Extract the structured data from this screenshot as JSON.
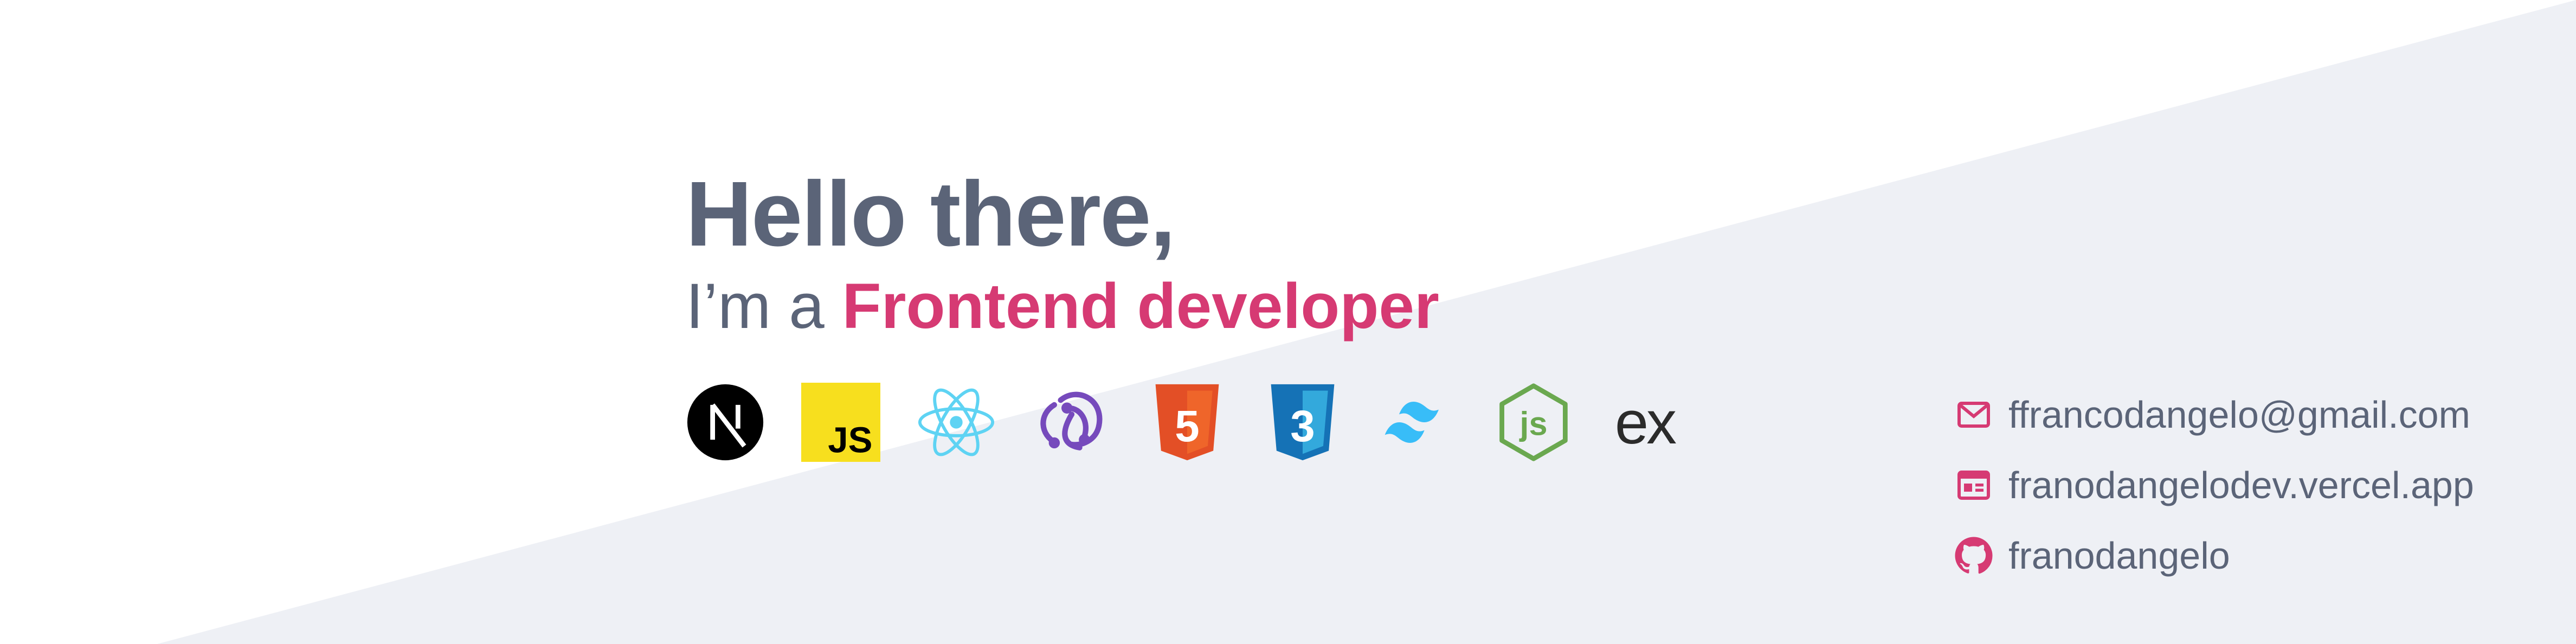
{
  "colors": {
    "background": "#ffffff",
    "diagonal_band": "#eef0f5",
    "text": "#5b6478",
    "accent": "#d63a73"
  },
  "intro": {
    "greeting": "Hello there,",
    "role_prefix": "I’m a ",
    "role": "Frontend developer"
  },
  "tech_icons": [
    {
      "icon": "nextjs-icon"
    },
    {
      "icon": "javascript-icon",
      "label": "JS"
    },
    {
      "icon": "react-icon"
    },
    {
      "icon": "redux-icon"
    },
    {
      "icon": "html5-icon",
      "label": "5"
    },
    {
      "icon": "css3-icon",
      "label": "3"
    },
    {
      "icon": "tailwind-icon"
    },
    {
      "icon": "nodejs-icon",
      "label": "js"
    },
    {
      "icon": "express-icon",
      "label": "ex"
    }
  ],
  "contacts": [
    {
      "icon": "mail-icon",
      "text": "ffrancodangelo@gmail.com"
    },
    {
      "icon": "website-icon",
      "text": "franodangelodev.vercel.app"
    },
    {
      "icon": "github-icon",
      "text": "franodangelo"
    }
  ]
}
